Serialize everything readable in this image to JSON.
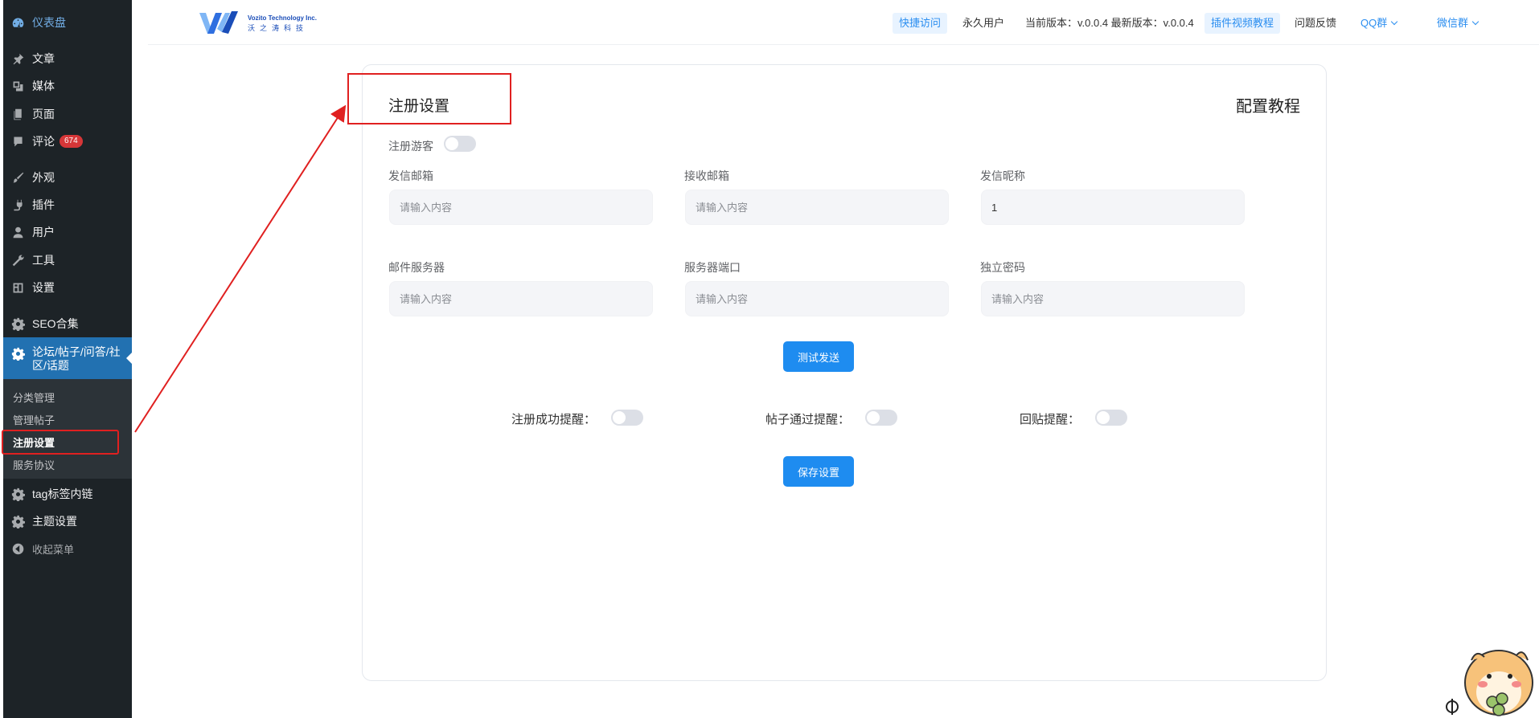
{
  "sidebar": {
    "dashboard": "仪表盘",
    "items": [
      {
        "label": "文章",
        "icon": "pin-icon"
      },
      {
        "label": "媒体",
        "icon": "media-icon"
      },
      {
        "label": "页面",
        "icon": "page-icon"
      },
      {
        "label": "评论",
        "icon": "comment-icon",
        "badge": "674"
      },
      {
        "label": "外观",
        "icon": "brush-icon"
      },
      {
        "label": "插件",
        "icon": "plugin-icon"
      },
      {
        "label": "用户",
        "icon": "user-icon"
      },
      {
        "label": "工具",
        "icon": "wrench-icon"
      },
      {
        "label": "设置",
        "icon": "settings-icon"
      },
      {
        "label": "SEO合集",
        "icon": "gear-icon"
      }
    ],
    "active": "论坛/帖子/问答/社区/话题",
    "submenu": [
      "分类管理",
      "管理帖子",
      "注册设置",
      "服务协议"
    ],
    "bottom": [
      "tag标签内链",
      "主题设置"
    ],
    "collapse": "收起菜单"
  },
  "header": {
    "logo_en": "Vozito Technology Inc.",
    "logo_cn": "沃之涛科技",
    "quick": "快捷访问",
    "user": "永久用户",
    "version": "当前版本：v.0.0.4 最新版本：v.0.0.4",
    "video": "插件视频教程",
    "feedback": "问题反馈",
    "qq": "QQ群",
    "wechat": "微信群"
  },
  "card": {
    "title": "注册设置",
    "help": "配置教程",
    "guest_label": "注册游客",
    "fields": [
      {
        "label": "发信邮箱",
        "value": "",
        "placeholder": "请输入内容"
      },
      {
        "label": "接收邮箱",
        "value": "",
        "placeholder": "请输入内容"
      },
      {
        "label": "发信昵称",
        "value": "1",
        "placeholder": "请输入内容"
      },
      {
        "label": "邮件服务器",
        "value": "",
        "placeholder": "请输入内容"
      },
      {
        "label": "服务器端口",
        "value": "",
        "placeholder": "请输入内容"
      },
      {
        "label": "独立密码",
        "value": "",
        "placeholder": "请输入内容"
      }
    ],
    "test_button": "测试发送",
    "switches": [
      "注册成功提醒：",
      "帖子通过提醒：",
      "回贴提醒："
    ],
    "save_button": "保存设置"
  },
  "colors": {
    "accent": "#1e8cf0",
    "sidebar": "#1d2327",
    "active": "#2271b1",
    "highlight": "#e02020"
  }
}
